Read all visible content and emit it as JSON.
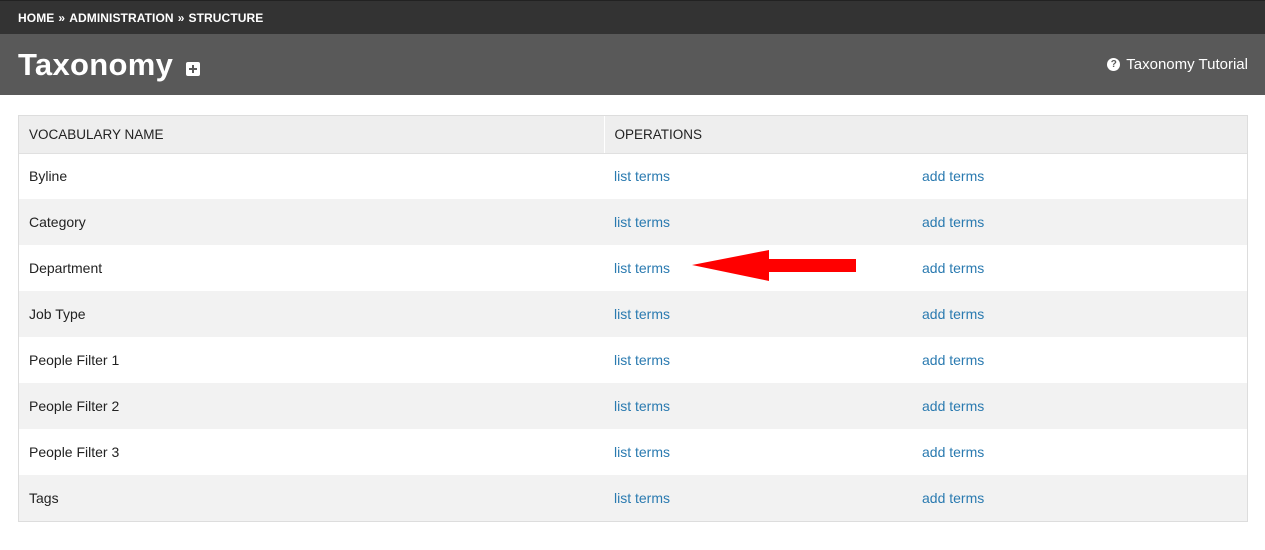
{
  "breadcrumb": {
    "items": [
      "HOME",
      "ADMINISTRATION",
      "STRUCTURE"
    ],
    "separator": "»"
  },
  "header": {
    "title": "Taxonomy",
    "add_icon": "plus-square-icon",
    "tutorial_icon": "question-circle-icon",
    "tutorial_label": "Taxonomy Tutorial"
  },
  "table": {
    "columns": [
      "VOCABULARY NAME",
      "OPERATIONS"
    ],
    "rows": [
      {
        "name": "Byline",
        "list": "list terms",
        "add": "add terms"
      },
      {
        "name": "Category",
        "list": "list terms",
        "add": "add terms"
      },
      {
        "name": "Department",
        "list": "list terms",
        "add": "add terms"
      },
      {
        "name": "Job Type",
        "list": "list terms",
        "add": "add terms"
      },
      {
        "name": "People Filter 1",
        "list": "list terms",
        "add": "add terms"
      },
      {
        "name": "People Filter 2",
        "list": "list terms",
        "add": "add terms"
      },
      {
        "name": "People Filter 3",
        "list": "list terms",
        "add": "add terms"
      },
      {
        "name": "Tags",
        "list": "list terms",
        "add": "add terms"
      }
    ]
  },
  "annotation": {
    "arrow_icon": "red-arrow-annotation",
    "arrow_color": "#ff0000"
  },
  "colors": {
    "breadcrumb_bg": "#333333",
    "title_bg": "#595959",
    "link": "#2a7ab0",
    "row_alt": "#f2f2f2",
    "header_row": "#eeeeee"
  }
}
